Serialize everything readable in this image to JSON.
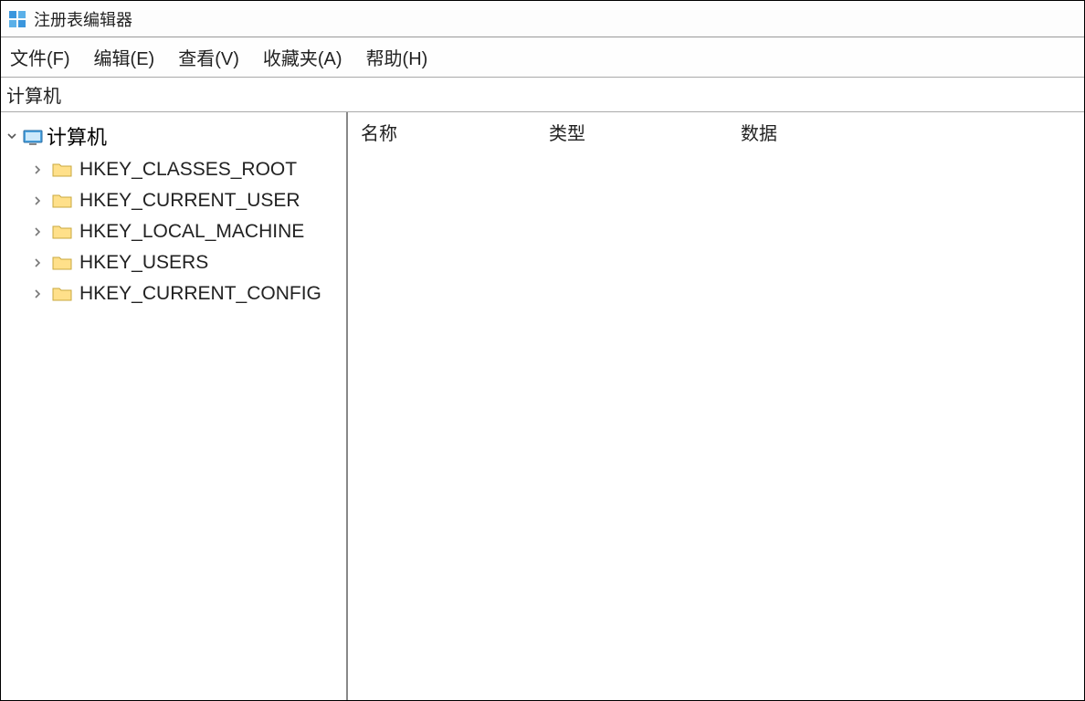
{
  "window": {
    "title": "注册表编辑器"
  },
  "menubar": {
    "file": "文件(F)",
    "edit": "编辑(E)",
    "view": "查看(V)",
    "favorites": "收藏夹(A)",
    "help": "帮助(H)"
  },
  "address": {
    "path": "计算机"
  },
  "tree": {
    "root": {
      "label": "计算机",
      "expanded": true
    },
    "children": [
      {
        "label": "HKEY_CLASSES_ROOT"
      },
      {
        "label": "HKEY_CURRENT_USER"
      },
      {
        "label": "HKEY_LOCAL_MACHINE"
      },
      {
        "label": "HKEY_USERS"
      },
      {
        "label": "HKEY_CURRENT_CONFIG"
      }
    ]
  },
  "list": {
    "columns": {
      "name": "名称",
      "type": "类型",
      "data": "数据"
    }
  }
}
